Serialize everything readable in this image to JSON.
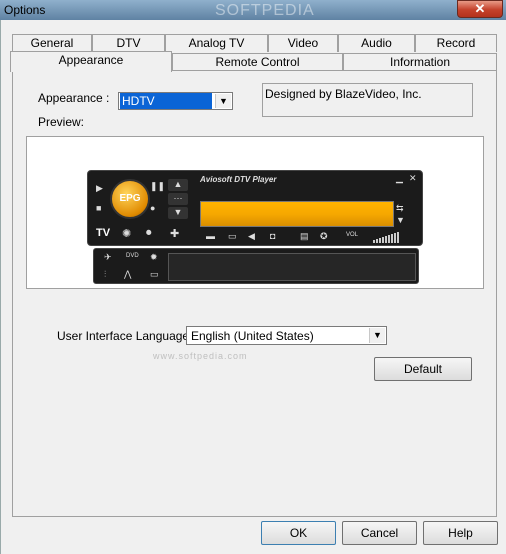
{
  "window": {
    "title": "Options",
    "close_glyph": "✕"
  },
  "tabs_row1": [
    {
      "label": "General"
    },
    {
      "label": "DTV"
    },
    {
      "label": "Analog TV"
    },
    {
      "label": "Video"
    },
    {
      "label": "Audio"
    },
    {
      "label": "Record"
    }
  ],
  "tabs_row2": [
    {
      "label": "Appearance",
      "selected": true
    },
    {
      "label": "Remote Control"
    },
    {
      "label": "Information"
    }
  ],
  "appearance": {
    "label": "Appearance :",
    "value": "HDTV",
    "info": "Designed by BlazeVideo, Inc.",
    "preview_label": "Preview:"
  },
  "player": {
    "title": "Aviosoft DTV Player",
    "epg": "EPG",
    "tv": "TV",
    "vol": "VOL",
    "dvd": "DVD"
  },
  "language": {
    "label": "User Interface Language:",
    "value": "English (United States)"
  },
  "buttons": {
    "default": "Default",
    "ok": "OK",
    "cancel": "Cancel",
    "help": "Help"
  },
  "watermarks": {
    "top": "SOFTPEDIA",
    "mid": "www.softpedia.com"
  },
  "colors": {
    "selection": "#0a64d6",
    "screen": "#f6a800",
    "titlebar": "#6f91b2"
  }
}
